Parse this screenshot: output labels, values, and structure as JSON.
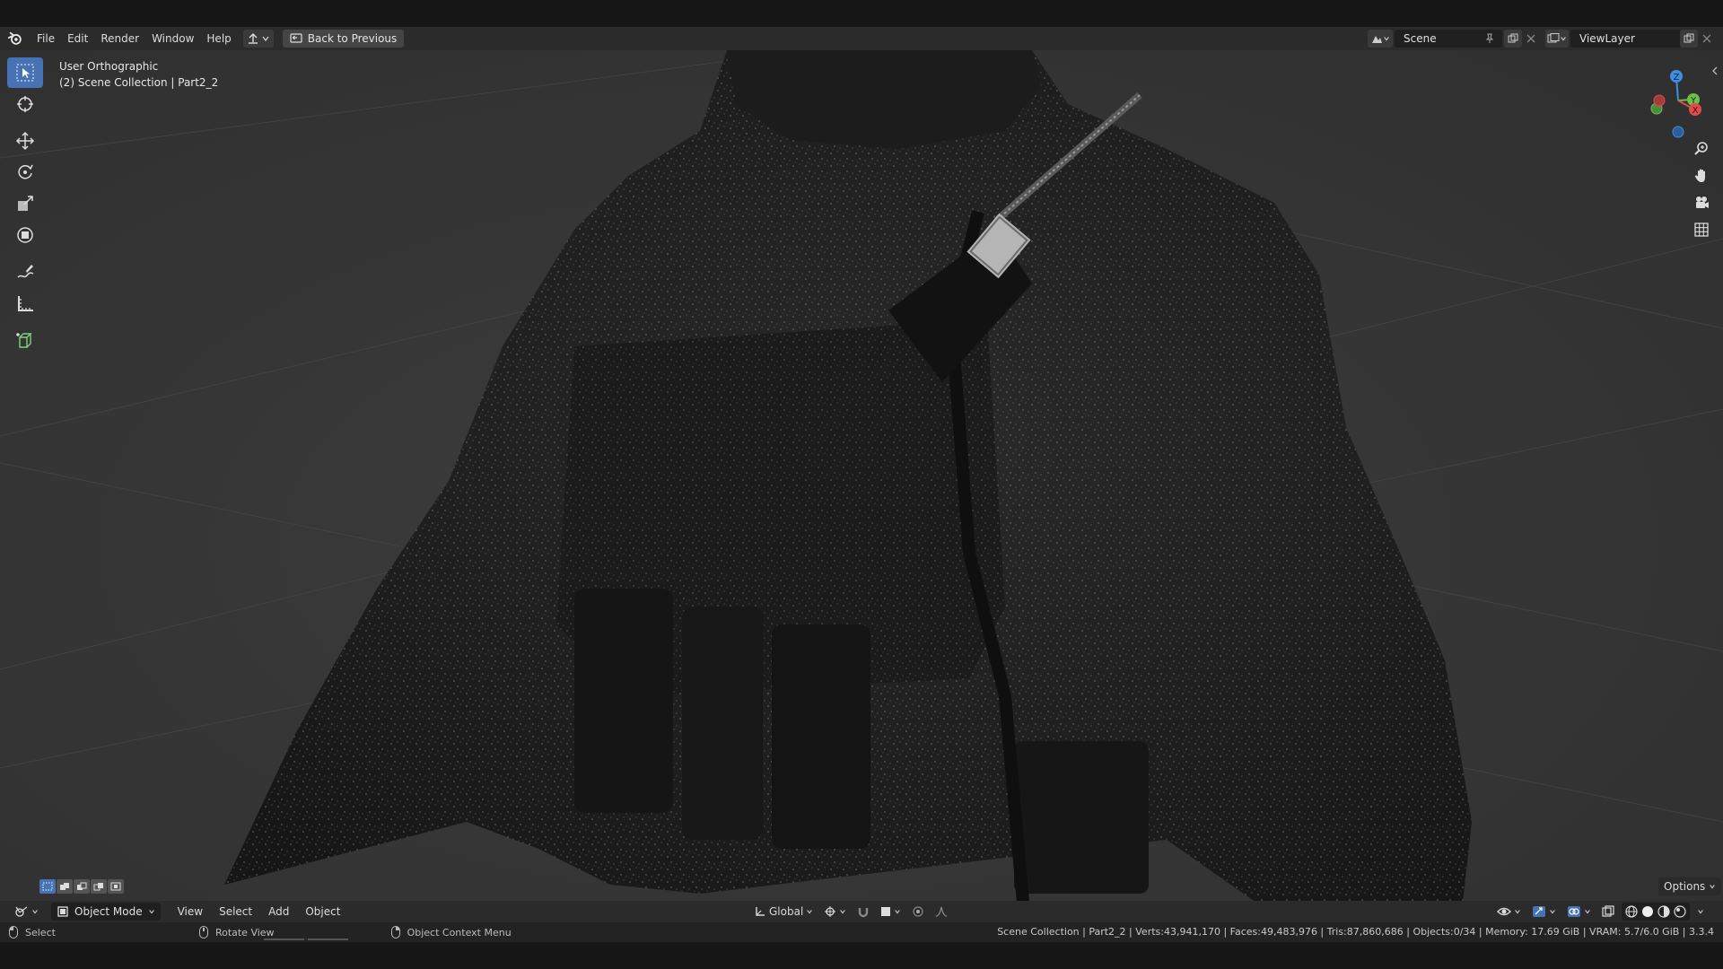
{
  "app": {
    "name": "Blender"
  },
  "menubar": {
    "items": [
      "File",
      "Edit",
      "Render",
      "Window",
      "Help"
    ],
    "back_button": "Back to Previous"
  },
  "scene_selector": {
    "value": "Scene"
  },
  "viewlayer_selector": {
    "value": "ViewLayer"
  },
  "viewport": {
    "view_name": "User Orthographic",
    "collection_info": "(2) Scene Collection | Part2_2",
    "options_label": "Options",
    "gizmo_axes": {
      "x": "X",
      "y": "Y",
      "z": "Z"
    }
  },
  "toolbar": {
    "tools": [
      "select-box",
      "cursor",
      "move",
      "rotate",
      "scale",
      "transform",
      "annotate",
      "measure",
      "add-cube"
    ],
    "active": "select-box"
  },
  "header": {
    "mode": "Object Mode",
    "menus": [
      "View",
      "Select",
      "Add",
      "Object"
    ],
    "transform_orientation": "Global"
  },
  "statusbar": {
    "left": [
      {
        "label": "Select"
      },
      {
        "label": "Rotate View"
      },
      {
        "label": "Object Context Menu"
      }
    ],
    "stats": "Scene Collection | Part2_2 | Verts:43,941,170 | Faces:49,483,976 | Tris:87,860,686 | Objects:0/34 | Memory: 17.69 GiB | VRAM: 5.7/6.0 GiB | 3.3.4"
  },
  "colors": {
    "accent": "#4772b3",
    "axis_x": "#e04c4c",
    "axis_y": "#6cc04a",
    "axis_z": "#3d8fe0"
  }
}
